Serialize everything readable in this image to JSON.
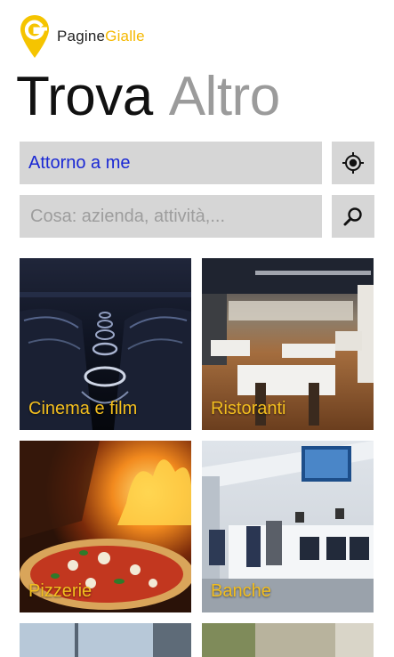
{
  "brand": {
    "name_part1": "Pagine",
    "name_part2": "Gialle",
    "color": "#f5b800"
  },
  "pivot": {
    "active": "Trova",
    "inactive": "Altro"
  },
  "location_field": {
    "value": "Attorno a me",
    "icon": "locate-icon"
  },
  "search_field": {
    "placeholder": "Cosa: azienda, attività,...",
    "value": "",
    "icon": "search-icon"
  },
  "categories": [
    {
      "label": "Cinema e film"
    },
    {
      "label": "Ristoranti"
    },
    {
      "label": "Pizzerie"
    },
    {
      "label": "Banche"
    }
  ],
  "colors": {
    "field_bg": "#d6d6d6",
    "link_blue": "#1a28d4",
    "tile_label": "#f3be1e"
  }
}
